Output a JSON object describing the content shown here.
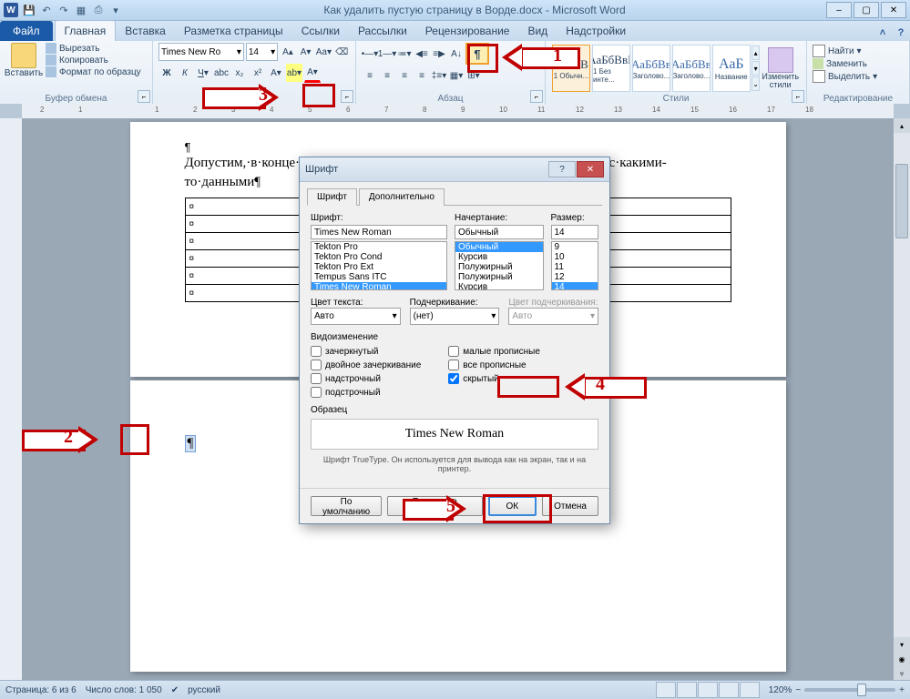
{
  "title": "Как удалить пустую страницу в Ворде.docx - Microsoft Word",
  "qat": [
    "💾",
    "↶",
    "↷",
    "📄",
    "🖨"
  ],
  "tabs": {
    "file": "Файл",
    "items": [
      "Главная",
      "Вставка",
      "Разметка страницы",
      "Ссылки",
      "Рассылки",
      "Рецензирование",
      "Вид",
      "Надстройки"
    ],
    "active": 0
  },
  "ribbon": {
    "clipboard": {
      "label": "Буфер обмена",
      "paste": "Вставить",
      "cut": "Вырезать",
      "copy": "Копировать",
      "format": "Формат по образцу"
    },
    "font": {
      "label": "Шрифт",
      "name": "Times New Ro",
      "size": "14"
    },
    "paragraph": {
      "label": "Абзац"
    },
    "styles": {
      "label": "Стили",
      "change": "Изменить стили",
      "items": [
        {
          "pv": "АаБбВ",
          "name": "1 Обычн..."
        },
        {
          "pv": "АаБбВвГ",
          "name": "1 Без инте..."
        },
        {
          "pv": "АаБбВв",
          "name": "Заголово..."
        },
        {
          "pv": "АаБбВв",
          "name": "Заголово..."
        },
        {
          "pv": "АаБ",
          "name": "Название"
        }
      ]
    },
    "editing": {
      "label": "Редактирование",
      "find": "Найти",
      "replace": "Заменить",
      "select": "Выделить"
    }
  },
  "ruler_ticks": [
    "2",
    "1",
    "",
    "1",
    "2",
    "3",
    "4",
    "5",
    "6",
    "7",
    "8",
    "9",
    "10",
    "11",
    "12",
    "13",
    "14",
    "15",
    "16",
    "17",
    "18"
  ],
  "document": {
    "para1": "Допустим,·в·конце·вашего·документа·с·текстом·располагается·таблица·с·какими-то·данными¶",
    "cellmark": "¤",
    "page2mark": "¶"
  },
  "dialog": {
    "title": "Шрифт",
    "tab1": "Шрифт",
    "tab2": "Дополнительно",
    "font_label": "Шрифт:",
    "font_value": "Times New Roman",
    "font_list": [
      "Tekton Pro",
      "Tekton Pro Cond",
      "Tekton Pro Ext",
      "Tempus Sans ITC",
      "Times New Roman"
    ],
    "style_label": "Начертание:",
    "style_value": "Обычный",
    "style_list": [
      "Обычный",
      "Курсив",
      "Полужирный",
      "Полужирный Курсив"
    ],
    "size_label": "Размер:",
    "size_value": "14",
    "size_list": [
      "9",
      "10",
      "11",
      "12",
      "14"
    ],
    "color_label": "Цвет текста:",
    "color_value": "Авто",
    "underline_label": "Подчеркивание:",
    "underline_value": "(нет)",
    "ucolor_label": "Цвет подчеркивания:",
    "ucolor_value": "Авто",
    "effects_label": "Видоизменение",
    "fx": {
      "strike": "зачеркнутый",
      "dstrike": "двойное зачеркивание",
      "super": "надстрочный",
      "sub": "подстрочный",
      "smallcaps": "малые прописные",
      "allcaps": "все прописные",
      "hidden": "скрытый"
    },
    "preview_label": "Образец",
    "preview_text": "Times New Roman",
    "hint": "Шрифт TrueType. Он используется для вывода как на экран, так и на принтер.",
    "btn_default": "По умолчанию",
    "btn_textfx": "Текстовые эффекты...",
    "btn_ok": "ОК",
    "btn_cancel": "Отмена"
  },
  "status": {
    "page": "Страница: 6 из 6",
    "words": "Число слов: 1 050",
    "lang": "русский",
    "zoom": "120%"
  },
  "callouts": {
    "n1": "1",
    "n2": "2",
    "n3": "3",
    "n4": "4",
    "n5": "5"
  }
}
